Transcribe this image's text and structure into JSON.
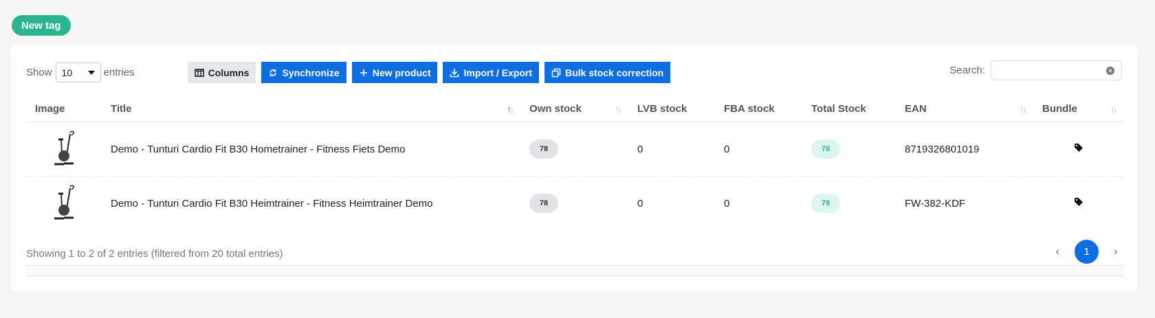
{
  "new_tag_label": "New tag",
  "toolbar": {
    "show_label": "Show",
    "entries_value": "10",
    "entries_label": "entries",
    "columns_label": "Columns",
    "synchronize_label": "Synchronize",
    "new_product_label": "New product",
    "import_export_label": "Import / Export",
    "bulk_stock_label": "Bulk stock correction"
  },
  "search": {
    "label": "Search:",
    "value": ""
  },
  "table": {
    "headers": {
      "image": "Image",
      "title": "Title",
      "own_stock": "Own stock",
      "lvb_stock": "LVB stock",
      "fba_stock": "FBA stock",
      "total_stock": "Total Stock",
      "ean": "EAN",
      "bundle": "Bundle"
    },
    "rows": [
      {
        "title": "Demo - Tunturi Cardio Fit B30 Hometrainer - Fitness Fiets Demo",
        "own_stock": "78",
        "lvb_stock": "0",
        "fba_stock": "0",
        "total_stock": "78",
        "ean": "8719326801019",
        "bundle_icon": "tag-icon"
      },
      {
        "title": "Demo - Tunturi Cardio Fit B30 Heimtrainer - Fitness Heimtrainer Demo",
        "own_stock": "78",
        "lvb_stock": "0",
        "fba_stock": "0",
        "total_stock": "78",
        "ean": "FW-382-KDF",
        "bundle_icon": "tag-icon"
      }
    ]
  },
  "footer": {
    "info": "Showing 1 to 2 of 2 entries (filtered from 20 total entries)",
    "prev": "‹",
    "current_page": "1",
    "next": "›"
  },
  "colors": {
    "primary": "#0d6ee0",
    "accent_green": "#2bb58f"
  }
}
